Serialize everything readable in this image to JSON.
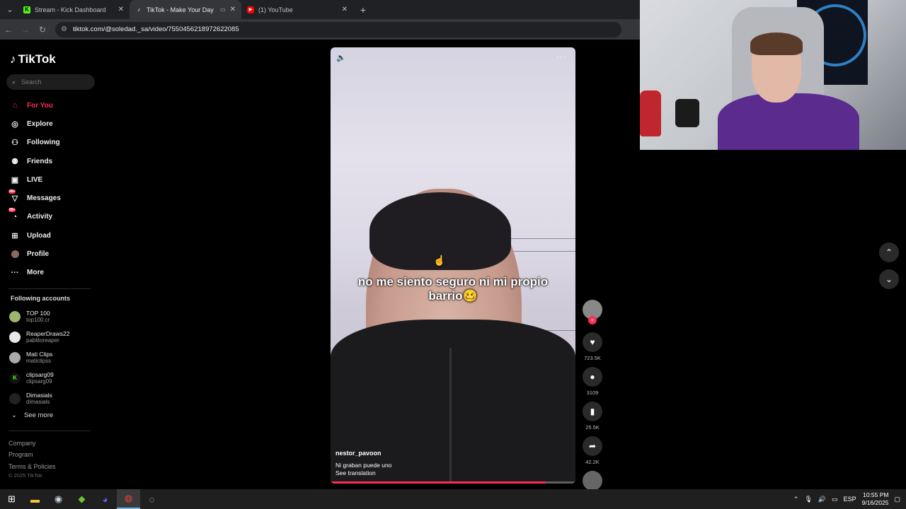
{
  "browser": {
    "tabs": [
      {
        "title": "Stream - Kick Dashboard",
        "favicon": "kick-icon",
        "color": "#53fc18"
      },
      {
        "title": "TikTok - Make Your Day",
        "favicon": "tiktok-icon",
        "color": "#ffffff"
      },
      {
        "title": "(1) YouTube",
        "favicon": "youtube-icon",
        "color": "#ff0000"
      }
    ],
    "url": "tiktok.com/@soledad._sa/video/7550456218972622085"
  },
  "sidebar": {
    "logo": "TikTok",
    "search_placeholder": "Search",
    "nav": [
      {
        "label": "For You",
        "icon": "home-icon",
        "active": true
      },
      {
        "label": "Explore",
        "icon": "compass-icon"
      },
      {
        "label": "Following",
        "icon": "following-icon"
      },
      {
        "label": "Friends",
        "icon": "friends-icon"
      },
      {
        "label": "LIVE",
        "icon": "live-icon"
      },
      {
        "label": "Messages",
        "icon": "messages-icon",
        "badge": "99+"
      },
      {
        "label": "Activity",
        "icon": "activity-icon",
        "badge": "99+"
      },
      {
        "label": "Upload",
        "icon": "upload-icon"
      },
      {
        "label": "Profile",
        "icon": "profile-avatar"
      },
      {
        "label": "More",
        "icon": "more-icon"
      }
    ],
    "following_title": "Following accounts",
    "accounts": [
      {
        "name": "TOP 100",
        "username": "top100.cr"
      },
      {
        "name": "ReaperDraws22",
        "username": "pablitoreaper"
      },
      {
        "name": "Mati Clips",
        "username": "maticlipss"
      },
      {
        "name": "clipsarg09",
        "username": "clipsarg09"
      },
      {
        "name": "Dimasials",
        "username": "dimasials"
      }
    ],
    "see_more": "See more",
    "footer_links": [
      "Company",
      "Program",
      "Terms & Policies"
    ],
    "copyright": "© 2025 TikTok"
  },
  "video": {
    "caption": "no me siento seguro ni mi propio barrio🥴",
    "author": "nestor_pavoon",
    "description": "Ni graban puede uno",
    "see_translation": "See translation",
    "progress": 0.88
  },
  "actions": {
    "likes": "723.5K",
    "comments": "3109",
    "saves": "25.5K",
    "shares": "42.2K"
  },
  "taskbar": {
    "language": "ESP",
    "time": "10:55 PM",
    "date": "9/16/2025"
  }
}
